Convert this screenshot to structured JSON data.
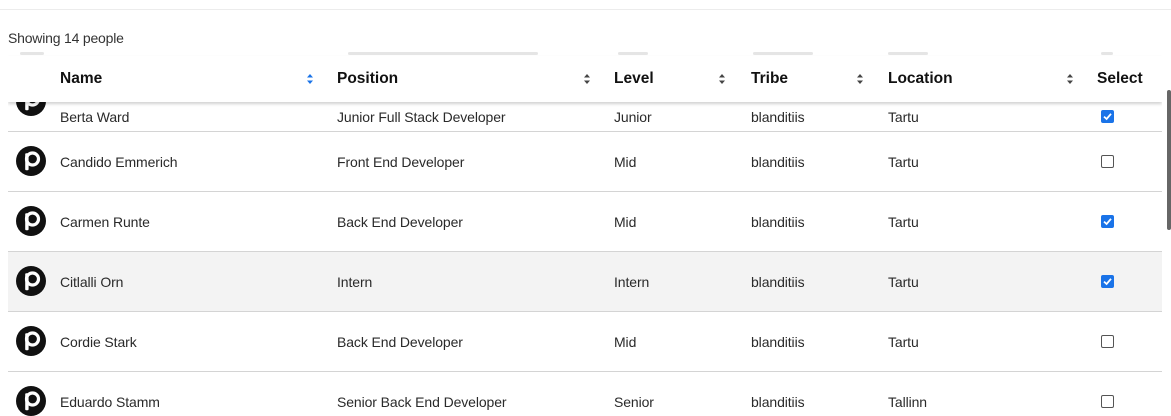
{
  "summary": {
    "count_text": "Showing 14 people"
  },
  "columns": [
    {
      "key": "name",
      "label": "Name"
    },
    {
      "key": "position",
      "label": "Position"
    },
    {
      "key": "level",
      "label": "Level"
    },
    {
      "key": "tribe",
      "label": "Tribe"
    },
    {
      "key": "location",
      "label": "Location"
    },
    {
      "key": "select",
      "label": "Select"
    }
  ],
  "rows": [
    {
      "name": "Berta Ward",
      "position": "Junior Full Stack Developer",
      "level": "Junior",
      "tribe": "blanditiis",
      "location": "Tartu",
      "selected": true
    },
    {
      "name": "Candido Emmerich",
      "position": "Front End Developer",
      "level": "Mid",
      "tribe": "blanditiis",
      "location": "Tartu",
      "selected": false
    },
    {
      "name": "Carmen Runte",
      "position": "Back End Developer",
      "level": "Mid",
      "tribe": "blanditiis",
      "location": "Tartu",
      "selected": true
    },
    {
      "name": "Citlalli Orn",
      "position": "Intern",
      "level": "Intern",
      "tribe": "blanditiis",
      "location": "Tartu",
      "selected": true
    },
    {
      "name": "Cordie Stark",
      "position": "Back End Developer",
      "level": "Mid",
      "tribe": "blanditiis",
      "location": "Tartu",
      "selected": false
    },
    {
      "name": "Eduardo Stamm",
      "position": "Senior Back End Developer",
      "level": "Senior",
      "tribe": "blanditiis",
      "location": "Tallinn",
      "selected": false
    }
  ],
  "colors": {
    "checkbox_checked": "#1a73e8",
    "header_bg": "#ffffff",
    "row_alt_bg": "#f3f3f3"
  },
  "icons": {
    "avatar": "pipedrive-p-icon",
    "sort": "sort-arrows-icon"
  }
}
